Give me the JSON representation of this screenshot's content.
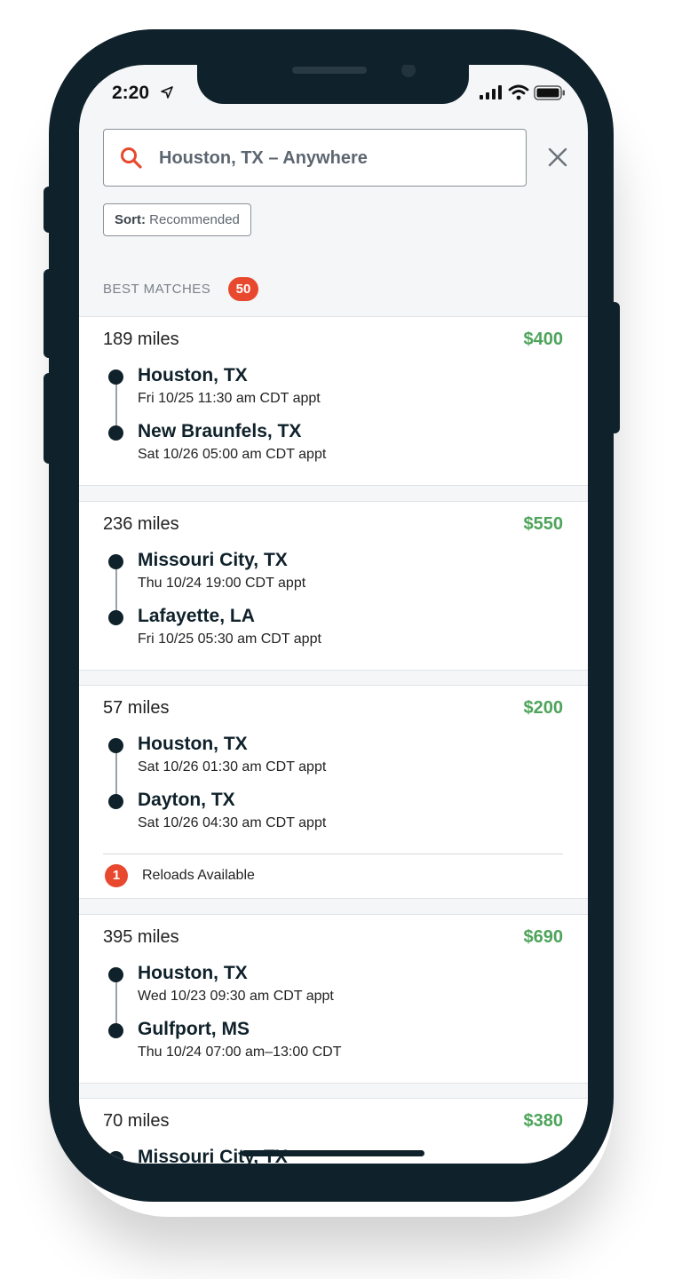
{
  "status": {
    "time": "2:20"
  },
  "search": {
    "value": "Houston, TX – Anywhere"
  },
  "sort": {
    "label": "Sort:",
    "value": "Recommended"
  },
  "section": {
    "title": "BEST MATCHES",
    "count": "50"
  },
  "loads": [
    {
      "miles": "189 miles",
      "price": "$400",
      "origin": {
        "city": "Houston, TX",
        "appt": "Fri 10/25 11:30 am CDT appt"
      },
      "destination": {
        "city": "New Braunfels, TX",
        "appt": "Sat 10/26 05:00 am CDT appt"
      }
    },
    {
      "miles": "236 miles",
      "price": "$550",
      "origin": {
        "city": "Missouri City, TX",
        "appt": "Thu 10/24 19:00 CDT appt"
      },
      "destination": {
        "city": "Lafayette, LA",
        "appt": "Fri 10/25 05:30 am CDT appt"
      }
    },
    {
      "miles": "57 miles",
      "price": "$200",
      "origin": {
        "city": "Houston, TX",
        "appt": "Sat 10/26 01:30 am CDT appt"
      },
      "destination": {
        "city": "Dayton, TX",
        "appt": "Sat 10/26 04:30 am CDT appt"
      },
      "reloads": {
        "count": "1",
        "label": "Reloads Available"
      }
    },
    {
      "miles": "395 miles",
      "price": "$690",
      "origin": {
        "city": "Houston, TX",
        "appt": "Wed 10/23 09:30 am CDT appt"
      },
      "destination": {
        "city": "Gulfport, MS",
        "appt": "Thu 10/24 07:00 am–13:00 CDT"
      }
    },
    {
      "miles": "70 miles",
      "price": "$380",
      "origin": {
        "city": "Missouri City, TX"
      }
    }
  ],
  "colors": {
    "accent": "#e8482e",
    "price": "#4da45a",
    "dark": "#0f212a"
  }
}
